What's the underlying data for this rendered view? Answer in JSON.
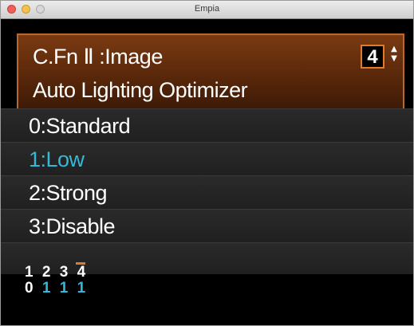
{
  "window": {
    "title": "Empia"
  },
  "header": {
    "line1": "C.Fn Ⅱ :Image",
    "line2": "Auto Lighting Optimizer",
    "page_number": "4",
    "stepper_up": "▲",
    "stepper_down": "▼"
  },
  "options": [
    {
      "label": "0:Standard",
      "selected": false
    },
    {
      "label": "1:Low",
      "selected": true
    },
    {
      "label": "2:Strong",
      "selected": false
    },
    {
      "label": "3:Disable",
      "selected": false
    }
  ],
  "footer": {
    "function_numbers": [
      "1",
      "2",
      "3",
      "4"
    ],
    "function_values": [
      "0",
      "1",
      "1",
      "1"
    ],
    "current_function": "4"
  },
  "colors": {
    "selected": "#35b8d8",
    "accent": "#e07a2a",
    "header_bg": "#5a280a"
  }
}
